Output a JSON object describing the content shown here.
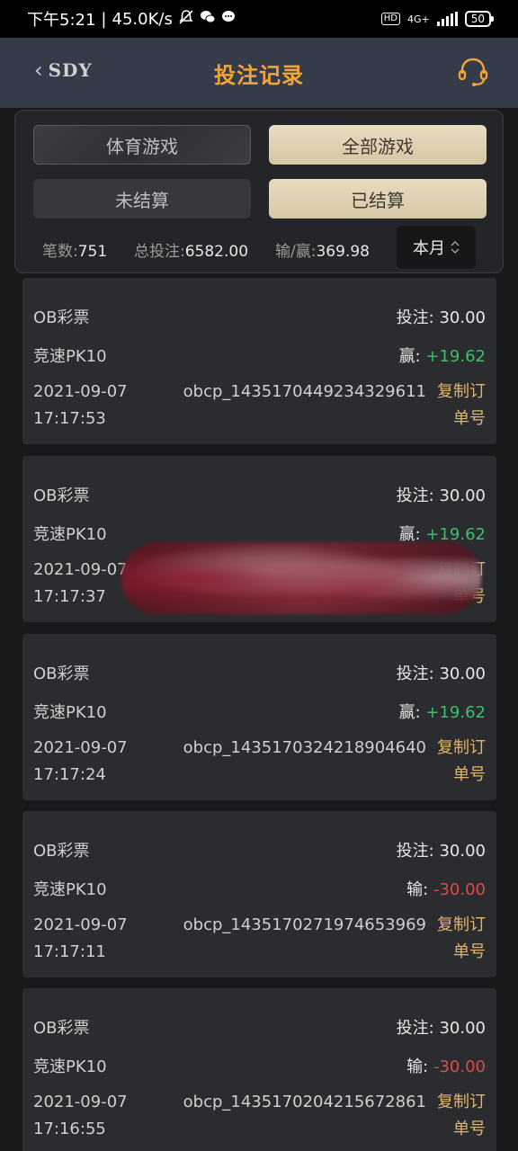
{
  "status_bar": {
    "time": "下午5:21",
    "speed": "45.0K/s",
    "hd": "HD",
    "network": "4G+",
    "battery": "50"
  },
  "header": {
    "logo": "SDY",
    "title": "投注记录"
  },
  "filters": {
    "sports": "体育游戏",
    "all": "全部游戏",
    "unsettled": "未结算",
    "settled": "已结算"
  },
  "stats": {
    "count_label": "笔数:",
    "count": "751",
    "total_label": "总投注:",
    "total": "6582.00",
    "pl_label": "输/赢:",
    "pl": "369.98",
    "period": "本月"
  },
  "records": [
    {
      "provider": "OB彩票",
      "bet_label": "投注:",
      "bet": "30.00",
      "game": "竞速PK10",
      "result_label": "赢:",
      "result": "+19.62",
      "result_type": "win",
      "date": "2021-09-07",
      "time": "17:17:53",
      "order": "obcp_1435170449234329611",
      "copy1": "复制订",
      "copy2": "单号"
    },
    {
      "provider": "OB彩票",
      "bet_label": "投注:",
      "bet": "30.00",
      "game": "竞速PK10",
      "result_label": "赢:",
      "result": "+19.62",
      "result_type": "win",
      "date": "2021-09-07",
      "time": "17:17:37",
      "order": "",
      "copy1": "复制订",
      "copy2": "单号"
    },
    {
      "provider": "OB彩票",
      "bet_label": "投注:",
      "bet": "30.00",
      "game": "竞速PK10",
      "result_label": "赢:",
      "result": "+19.62",
      "result_type": "win",
      "date": "2021-09-07",
      "time": "17:17:24",
      "order": "obcp_1435170324218904640",
      "copy1": "复制订",
      "copy2": "单号"
    },
    {
      "provider": "OB彩票",
      "bet_label": "投注:",
      "bet": "30.00",
      "game": "竞速PK10",
      "result_label": "输:",
      "result": "-30.00",
      "result_type": "lose",
      "date": "2021-09-07",
      "time": "17:17:11",
      "order": "obcp_1435170271974653969",
      "copy1": "复制订",
      "copy2": "单号"
    },
    {
      "provider": "OB彩票",
      "bet_label": "投注:",
      "bet": "30.00",
      "game": "竞速PK10",
      "result_label": "输:",
      "result": "-30.00",
      "result_type": "lose",
      "date": "2021-09-07",
      "time": "17:16:55",
      "order": "obcp_1435170204215672861",
      "copy1": "复制订",
      "copy2": "单号"
    }
  ],
  "colors": {
    "accent": "#f0a43a",
    "win": "#3cbf6a",
    "lose": "#e04848",
    "gold_button": "#ddd0b0"
  }
}
